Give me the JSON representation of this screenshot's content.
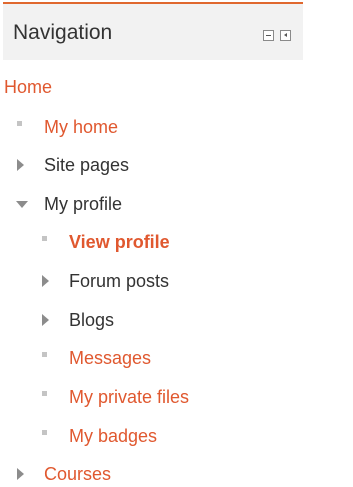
{
  "block": {
    "title": "Navigation",
    "accent_color": "#e0682f",
    "collapse_icon": "minus-box-icon",
    "dock_icon": "dock-left-icon"
  },
  "nav": {
    "home": "Home",
    "my_home": "My home",
    "site_pages": "Site pages",
    "my_profile": "My profile",
    "view_profile": "View profile",
    "forum_posts": "Forum posts",
    "blogs": "Blogs",
    "messages": "Messages",
    "my_private_files": "My private files",
    "my_badges": "My badges",
    "courses": "Courses"
  },
  "colors": {
    "link": "#e0582f",
    "text": "#333333",
    "bullet": "#c4c4c4",
    "arrow": "#8c8c8c"
  }
}
